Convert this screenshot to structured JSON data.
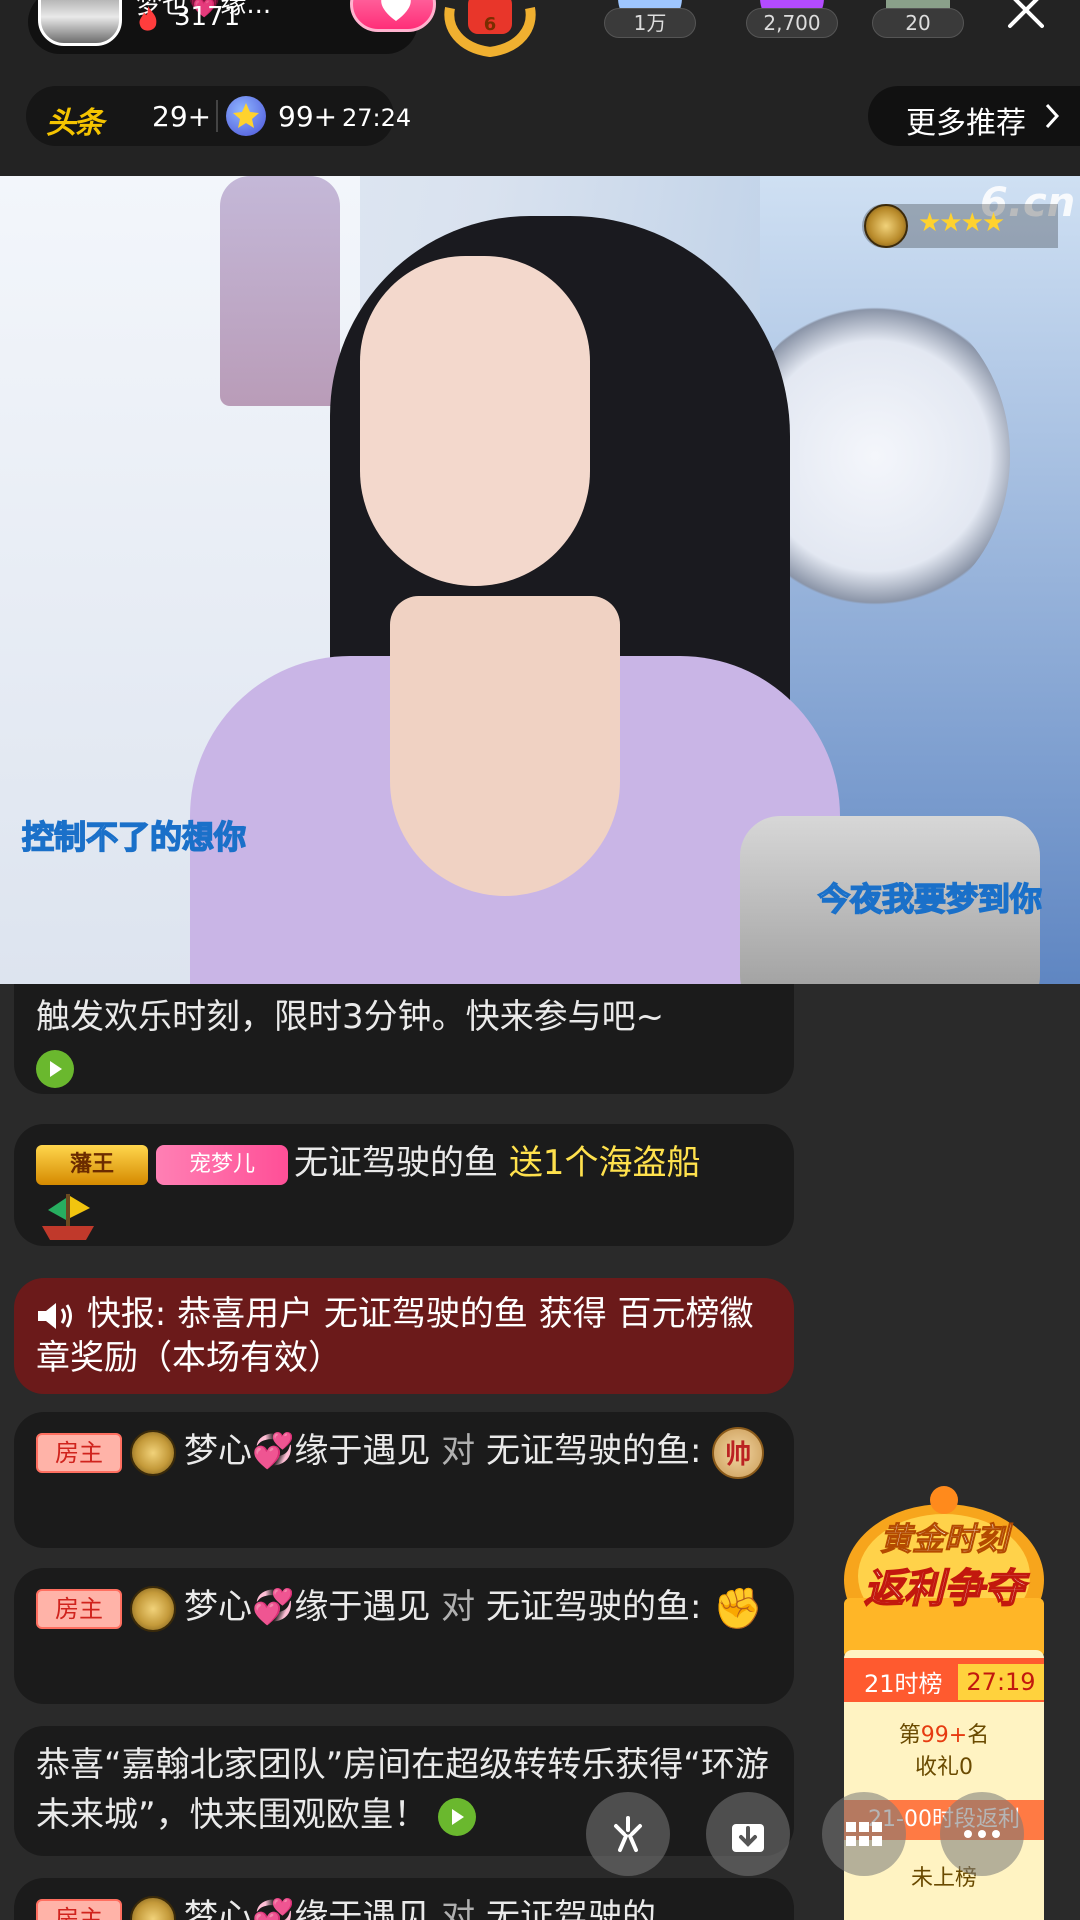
{
  "header": {
    "host_name": "梦也💗缘...",
    "host_heat": "3171",
    "rank_number": "6",
    "viewers": [
      {
        "count": "1万",
        "color": "#9ec6ff"
      },
      {
        "count": "2,700",
        "color": "#b34bff"
      },
      {
        "count": "20",
        "color": "#8aa08a"
      }
    ],
    "toutiao_logo": "头条",
    "toutiao_count": "29+",
    "star_count": "99+",
    "star_time": "27:24",
    "more_label": "更多推荐"
  },
  "video": {
    "brand_logo": "6.cn",
    "streamer_stars": "★★★★",
    "lyric_left": "控制不了的想你",
    "lyric_right": "今夜我要梦到你"
  },
  "chat": {
    "msg1": {
      "text": "触发欢乐时刻，限时3分钟。快来参与吧~"
    },
    "msg2": {
      "badge_king": "藩王",
      "badge_pet": "宠梦儿",
      "user": "无证驾驶的鱼",
      "gift": "送1个海盗船"
    },
    "msg3": {
      "prefix": "快报:",
      "text": "恭喜用户 无证驾驶的鱼 获得 百元榜徽章奖励（本场有效）"
    },
    "msg4": {
      "tag": "房主",
      "user": "梦心💞缘于遇见",
      "to": "对",
      "target": "无证驾驶的鱼:",
      "emoji": "帅"
    },
    "msg5": {
      "tag": "房主",
      "user": "梦心💞缘于遇见",
      "to": "对",
      "target": "无证驾驶的鱼:",
      "emoji": "✊"
    },
    "msg6": {
      "text": "恭喜“嘉翰北家团队”房间在超级转转乐获得“环游未来城”，快来围观欧皇！"
    },
    "msg7": {
      "tag": "房主",
      "user": "梦心💞缘于遇见",
      "to": "对",
      "target": "无证驾驶的"
    }
  },
  "promo": {
    "title_line1": "黄金时刻",
    "title_line2": "返利争夺",
    "board_label": "21时榜",
    "countdown": "27:19",
    "rank_prefix": "第",
    "rank_value": "99+",
    "rank_suffix": "名",
    "gift_label": "收礼0",
    "period_label": "21-00时段返利",
    "status": "未上榜"
  },
  "bottom_buttons": [
    "share-icon",
    "download-icon",
    "grid-icon",
    "more-icon"
  ]
}
